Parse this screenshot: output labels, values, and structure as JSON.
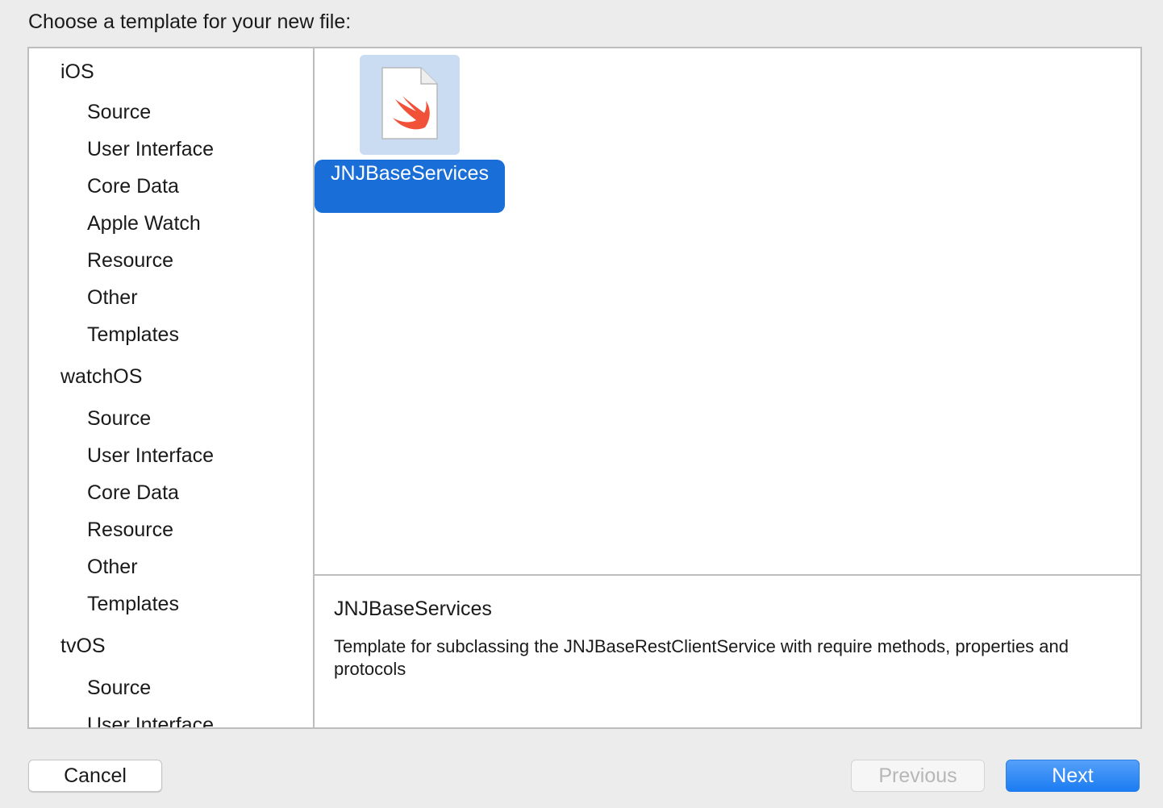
{
  "dialog": {
    "prompt": "Choose a template for your new file:"
  },
  "sidebar": {
    "groups": [
      {
        "platform": "iOS",
        "categories": [
          "Source",
          "User Interface",
          "Core Data",
          "Apple Watch",
          "Resource",
          "Other",
          "Templates"
        ]
      },
      {
        "platform": "watchOS",
        "categories": [
          "Source",
          "User Interface",
          "Core Data",
          "Resource",
          "Other",
          "Templates"
        ]
      },
      {
        "platform": "tvOS",
        "categories": [
          "Source",
          "User Interface"
        ]
      }
    ]
  },
  "templates": {
    "items": [
      {
        "name": "JNJBaseServices",
        "icon": "swift-file-icon",
        "selected": true
      }
    ]
  },
  "description": {
    "title": "JNJBaseServices",
    "text": "Template for subclassing the JNJBaseRestClientService with require methods, properties and protocols"
  },
  "buttons": {
    "cancel": "Cancel",
    "previous": "Previous",
    "next": "Next"
  },
  "colors": {
    "selection": "#1a6ed8",
    "icon_tile": "#c9dcf2",
    "next_button": "#1b7cf2",
    "swift_orange": "#f05138"
  }
}
